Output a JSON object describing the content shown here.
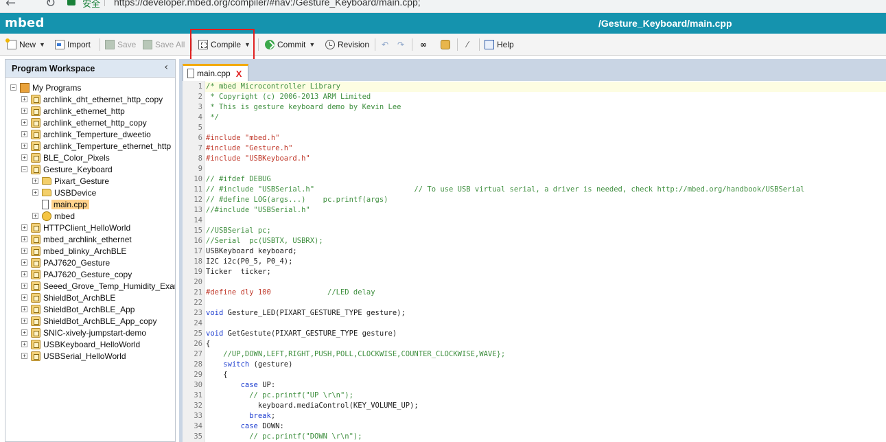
{
  "browser": {
    "secure_label": "安全",
    "url": "https://developer.mbed.org/compiler/#nav:/Gesture_Keyboard/main.cpp;"
  },
  "app": {
    "logo": "mbed",
    "path": "/Gesture_Keyboard/main.cpp"
  },
  "toolbar": {
    "new": "New",
    "import": "Import",
    "save": "Save",
    "save_all": "Save All",
    "compile": "Compile",
    "commit": "Commit",
    "revision": "Revision",
    "help": "Help"
  },
  "workspace": {
    "title": "Program Workspace",
    "root": "My Programs",
    "items": [
      {
        "label": "archlink_dht_ethernet_http_copy",
        "level": 1,
        "type": "prog",
        "expander": "+"
      },
      {
        "label": "archlink_ethernet_http",
        "level": 1,
        "type": "prog",
        "expander": "+"
      },
      {
        "label": "archlink_ethernet_http_copy",
        "level": 1,
        "type": "prog",
        "expander": "+"
      },
      {
        "label": "archlink_Temperture_dweetio",
        "level": 1,
        "type": "prog",
        "expander": "+"
      },
      {
        "label": "archlink_Temperture_ethernet_http",
        "level": 1,
        "type": "prog",
        "expander": "+"
      },
      {
        "label": "BLE_Color_Pixels",
        "level": 1,
        "type": "prog",
        "expander": "+"
      },
      {
        "label": "Gesture_Keyboard",
        "level": 1,
        "type": "prog",
        "expander": "-"
      },
      {
        "label": "Pixart_Gesture",
        "level": 2,
        "type": "folder",
        "expander": "+"
      },
      {
        "label": "USBDevice",
        "level": 2,
        "type": "folder",
        "expander": "+"
      },
      {
        "label": "main.cpp",
        "level": 2,
        "type": "file",
        "expander": "",
        "selected": true
      },
      {
        "label": "mbed",
        "level": 2,
        "type": "lib",
        "expander": "+"
      },
      {
        "label": "HTTPClient_HelloWorld",
        "level": 1,
        "type": "prog",
        "expander": "+"
      },
      {
        "label": "mbed_archlink_ethernet",
        "level": 1,
        "type": "prog",
        "expander": "+"
      },
      {
        "label": "mbed_blinky_ArchBLE",
        "level": 1,
        "type": "prog",
        "expander": "+"
      },
      {
        "label": "PAJ7620_Gesture",
        "level": 1,
        "type": "prog",
        "expander": "+"
      },
      {
        "label": "PAJ7620_Gesture_copy",
        "level": 1,
        "type": "prog",
        "expander": "+"
      },
      {
        "label": "Seeed_Grove_Temp_Humidity_Example",
        "level": 1,
        "type": "prog",
        "expander": "+"
      },
      {
        "label": "ShieldBot_ArchBLE",
        "level": 1,
        "type": "prog",
        "expander": "+"
      },
      {
        "label": "ShieldBot_ArchBLE_App",
        "level": 1,
        "type": "prog",
        "expander": "+"
      },
      {
        "label": "ShieldBot_ArchBLE_App_copy",
        "level": 1,
        "type": "prog",
        "expander": "+"
      },
      {
        "label": "SNIC-xively-jumpstart-demo",
        "level": 1,
        "type": "prog",
        "expander": "+"
      },
      {
        "label": "USBKeyboard_HelloWorld",
        "level": 1,
        "type": "prog",
        "expander": "+"
      },
      {
        "label": "USBSerial_HelloWorld",
        "level": 1,
        "type": "prog",
        "expander": "+"
      }
    ]
  },
  "editor": {
    "tab_label": "main.cpp",
    "tab_close": "X",
    "lines": [
      {
        "n": "1",
        "segs": [
          {
            "t": "/* mbed Microcontroller Library",
            "c": "comment"
          }
        ]
      },
      {
        "n": "2",
        "segs": [
          {
            "t": " * Copyright (c) 2006-2013 ARM Limited",
            "c": "comment"
          }
        ]
      },
      {
        "n": "3",
        "segs": [
          {
            "t": " * This is gesture keyboard demo by Kevin Lee",
            "c": "comment"
          }
        ]
      },
      {
        "n": "4",
        "segs": [
          {
            "t": " */",
            "c": "comment"
          }
        ]
      },
      {
        "n": "5",
        "segs": []
      },
      {
        "n": "6",
        "segs": [
          {
            "t": "#include \"mbed.h\"",
            "c": "pre"
          }
        ]
      },
      {
        "n": "7",
        "segs": [
          {
            "t": "#include \"Gesture.h\"",
            "c": "pre"
          }
        ]
      },
      {
        "n": "8",
        "segs": [
          {
            "t": "#include \"USBKeyboard.h\"",
            "c": "pre"
          }
        ]
      },
      {
        "n": "9",
        "segs": []
      },
      {
        "n": "10",
        "segs": [
          {
            "t": "// #ifdef DEBUG",
            "c": "comment"
          }
        ]
      },
      {
        "n": "11",
        "segs": [
          {
            "t": "// #include \"USBSerial.h\"                       // To use USB virtual serial, a driver is needed, check http://mbed.org/handbook/USBSerial",
            "c": "comment"
          }
        ]
      },
      {
        "n": "12",
        "segs": [
          {
            "t": "// #define LOG(args...)    pc.printf(args)",
            "c": "comment"
          }
        ]
      },
      {
        "n": "13",
        "segs": [
          {
            "t": "//#include \"USBSerial.h\"",
            "c": "comment"
          }
        ]
      },
      {
        "n": "14",
        "segs": []
      },
      {
        "n": "15",
        "segs": [
          {
            "t": "//USBSerial pc;",
            "c": "comment"
          }
        ]
      },
      {
        "n": "16",
        "segs": [
          {
            "t": "//Serial  pc(USBTX, USBRX);",
            "c": "comment"
          }
        ]
      },
      {
        "n": "17",
        "segs": [
          {
            "t": "USBKeyboard keyboard;",
            "c": "plain"
          }
        ]
      },
      {
        "n": "18",
        "segs": [
          {
            "t": "I2C i2c(P0_5, P0_4);",
            "c": "plain"
          }
        ]
      },
      {
        "n": "19",
        "segs": [
          {
            "t": "Ticker  ticker;",
            "c": "plain"
          }
        ]
      },
      {
        "n": "20",
        "segs": []
      },
      {
        "n": "21",
        "segs": [
          {
            "t": "#define dly 100",
            "c": "pre"
          },
          {
            "t": "             //LED delay",
            "c": "comment"
          }
        ]
      },
      {
        "n": "22",
        "segs": []
      },
      {
        "n": "23",
        "segs": [
          {
            "t": "void",
            "c": "kw"
          },
          {
            "t": " Gesture_LED(PIXART_GESTURE_TYPE gesture);",
            "c": "plain"
          }
        ]
      },
      {
        "n": "24",
        "segs": []
      },
      {
        "n": "25",
        "segs": [
          {
            "t": "void",
            "c": "kw"
          },
          {
            "t": " GetGestute(PIXART_GESTURE_TYPE gesture)",
            "c": "plain"
          }
        ]
      },
      {
        "n": "26",
        "segs": [
          {
            "t": "{",
            "c": "plain"
          }
        ]
      },
      {
        "n": "27",
        "segs": [
          {
            "t": "    //UP,DOWN,LEFT,RIGHT,PUSH,POLL,CLOCKWISE,COUNTER_CLOCKWISE,WAVE};",
            "c": "comment"
          }
        ]
      },
      {
        "n": "28",
        "segs": [
          {
            "t": "    ",
            "c": "plain"
          },
          {
            "t": "switch",
            "c": "kw"
          },
          {
            "t": " (gesture)",
            "c": "plain"
          }
        ]
      },
      {
        "n": "29",
        "segs": [
          {
            "t": "    {",
            "c": "plain"
          }
        ]
      },
      {
        "n": "30",
        "segs": [
          {
            "t": "        ",
            "c": "plain"
          },
          {
            "t": "case",
            "c": "kw"
          },
          {
            "t": " UP:",
            "c": "plain"
          }
        ]
      },
      {
        "n": "31",
        "segs": [
          {
            "t": "          // pc.printf(\"UP \\r\\n\");",
            "c": "comment"
          }
        ]
      },
      {
        "n": "32",
        "segs": [
          {
            "t": "            keyboard.mediaControl(KEY_VOLUME_UP);",
            "c": "plain"
          }
        ]
      },
      {
        "n": "33",
        "segs": [
          {
            "t": "          ",
            "c": "plain"
          },
          {
            "t": "break",
            "c": "kw"
          },
          {
            "t": ";",
            "c": "plain"
          }
        ]
      },
      {
        "n": "34",
        "segs": [
          {
            "t": "        ",
            "c": "plain"
          },
          {
            "t": "case",
            "c": "kw"
          },
          {
            "t": " DOWN:",
            "c": "plain"
          }
        ]
      },
      {
        "n": "35",
        "segs": [
          {
            "t": "          // pc.printf(\"DOWN \\r\\n\");",
            "c": "comment"
          }
        ]
      }
    ]
  }
}
